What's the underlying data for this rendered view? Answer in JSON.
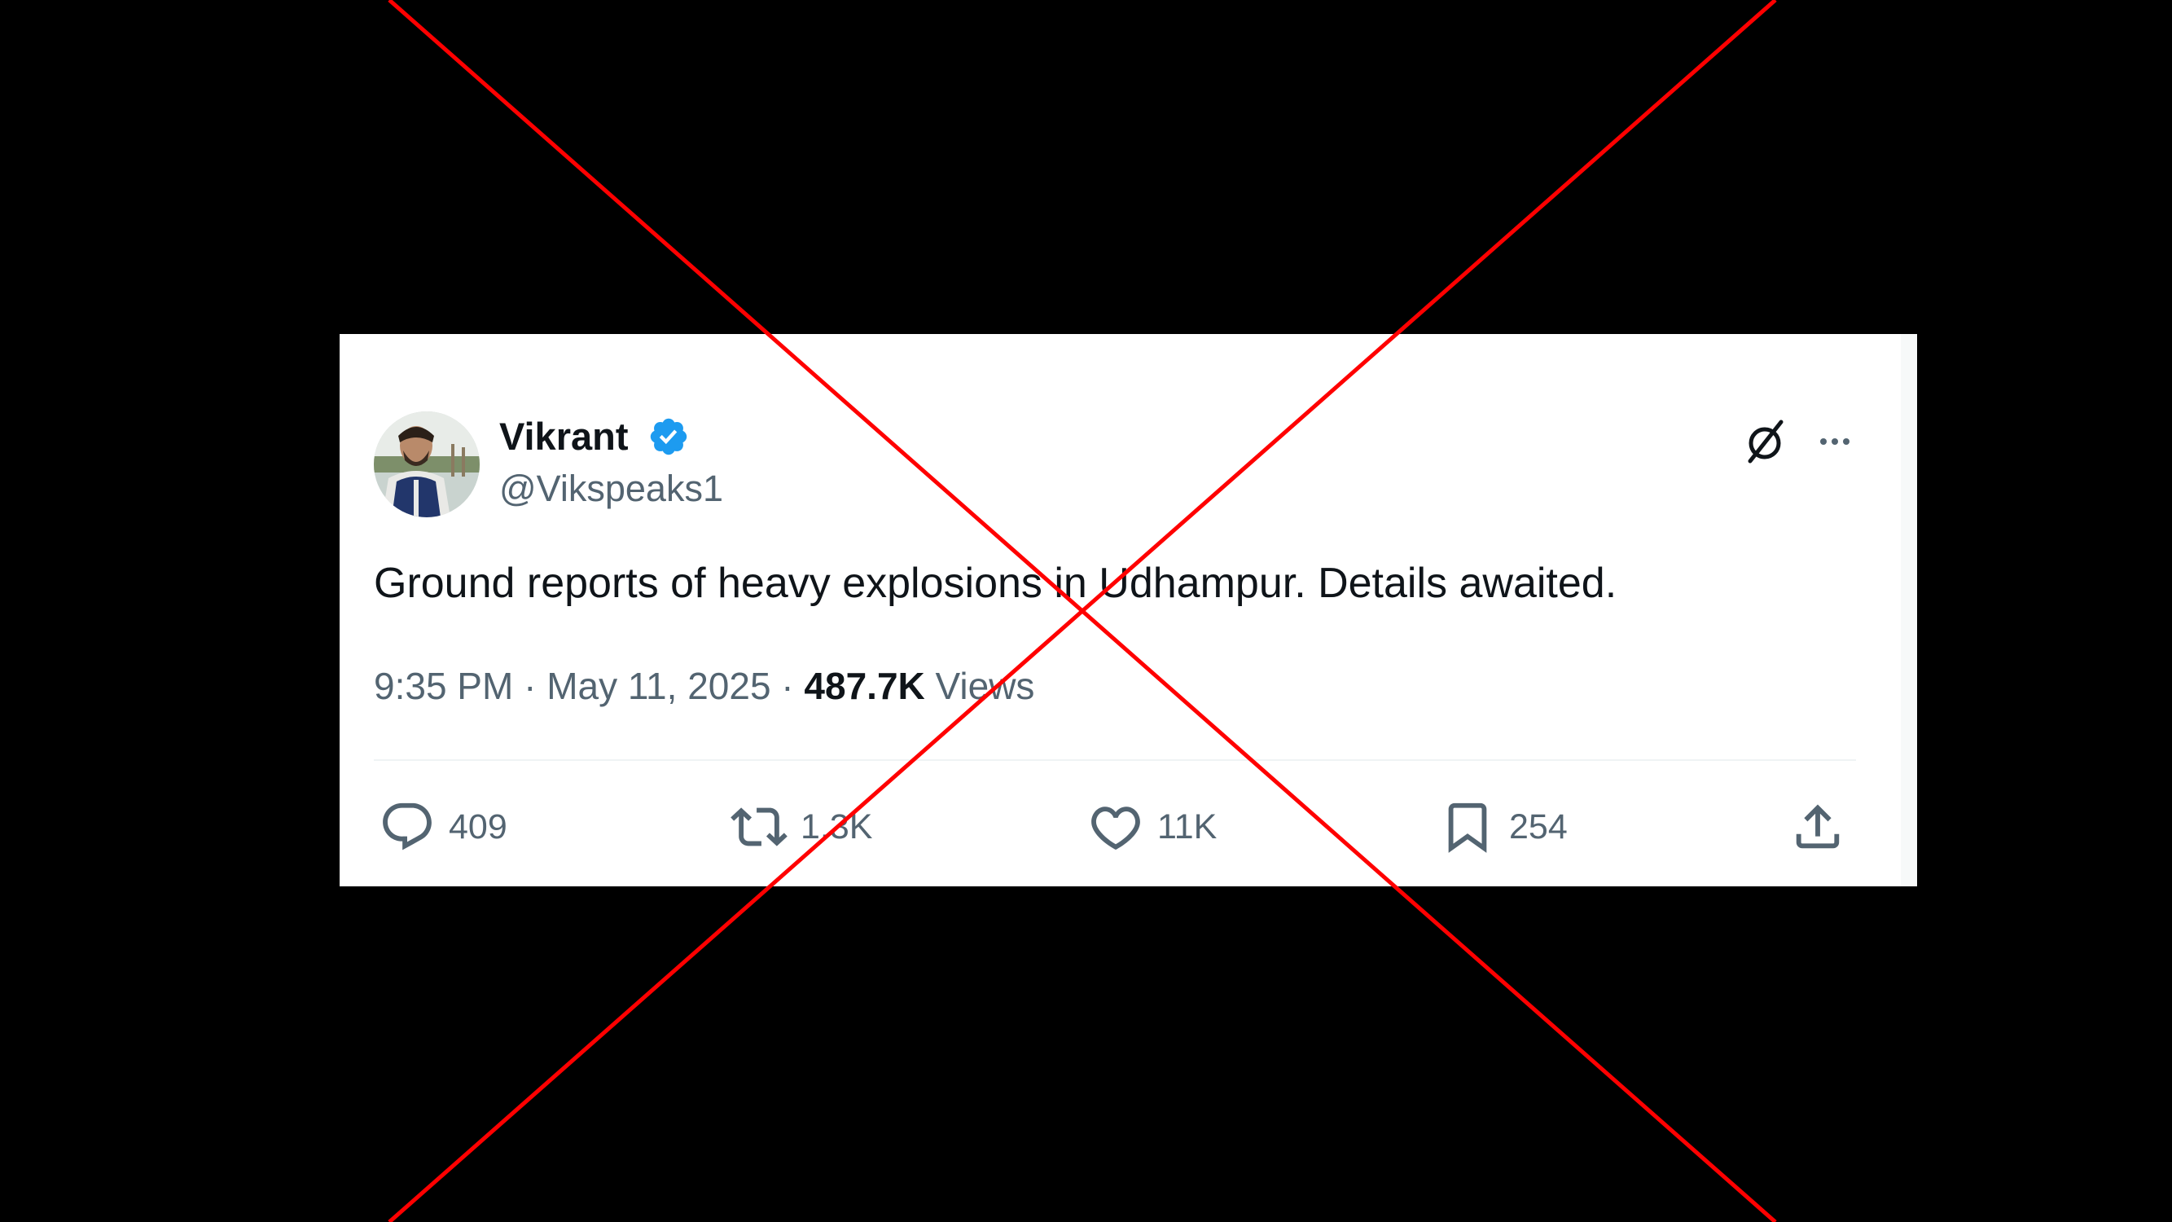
{
  "tweet": {
    "display_name": "Vikrant",
    "handle": "@Vikspeaks1",
    "verified_icon": "verified-badge-icon",
    "text": "Ground reports of heavy explosions in Udhampur. Details awaited.",
    "time": "9:35 PM",
    "separator": " · ",
    "date": "May 11, 2025",
    "views_count": "487.7K",
    "views_label": " Views"
  },
  "actions": {
    "reply_count": "409",
    "retweet_count": "1.3K",
    "like_count": "11K",
    "bookmark_count": "254"
  },
  "icons": {
    "grok": "grok-icon",
    "more": "more-options-icon",
    "reply": "reply-icon",
    "retweet": "retweet-icon",
    "like": "heart-icon",
    "bookmark": "bookmark-icon",
    "share": "share-icon"
  },
  "colors": {
    "background": "#000000",
    "card": "#ffffff",
    "text_primary": "#0f1419",
    "text_secondary": "#536471",
    "verified": "#1d9bf0",
    "cross_mark": "#ff0000"
  }
}
